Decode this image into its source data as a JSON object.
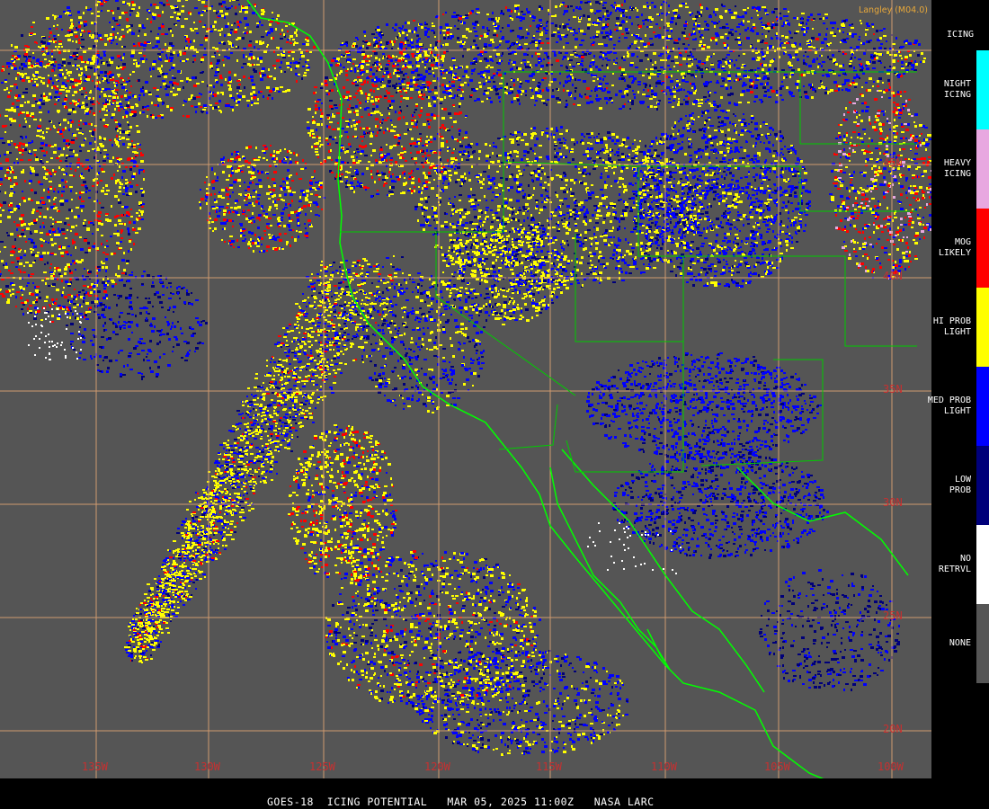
{
  "product": {
    "footer": "GOES-18  ICING POTENTIAL   MAR 05, 2025 11:00Z   NASA LARC",
    "credit": "Langley (M04.0)"
  },
  "legend": {
    "title": "ICING",
    "items": [
      {
        "label": "NIGHT\nICING",
        "color": "#00ffff"
      },
      {
        "label": "HEAVY\nICING",
        "color": "#e8a8e0"
      },
      {
        "label": "MOG\nLIKELY",
        "color": "#ff0000"
      },
      {
        "label": "HI PROB\nLIGHT",
        "color": "#ffff00"
      },
      {
        "label": "MED PROB\nLIGHT",
        "color": "#0000ff"
      },
      {
        "label": "LOW\nPROB",
        "color": "#00007a"
      },
      {
        "label": "NO\nRETRVL",
        "color": "#ffffff"
      },
      {
        "label": "NONE",
        "color": "#555555"
      }
    ]
  },
  "latitude_labels": [
    "45N",
    "40N",
    "35N",
    "30N",
    "25N",
    "20N"
  ],
  "longitude_labels": [
    "135W",
    "130W",
    "125W",
    "120W",
    "115W",
    "110W",
    "105W",
    "100W"
  ],
  "colors": {
    "background": "#555555",
    "grid": "#d09a70",
    "coast": "#00ff00",
    "borders": "#00cc00",
    "label": "#c73030"
  }
}
